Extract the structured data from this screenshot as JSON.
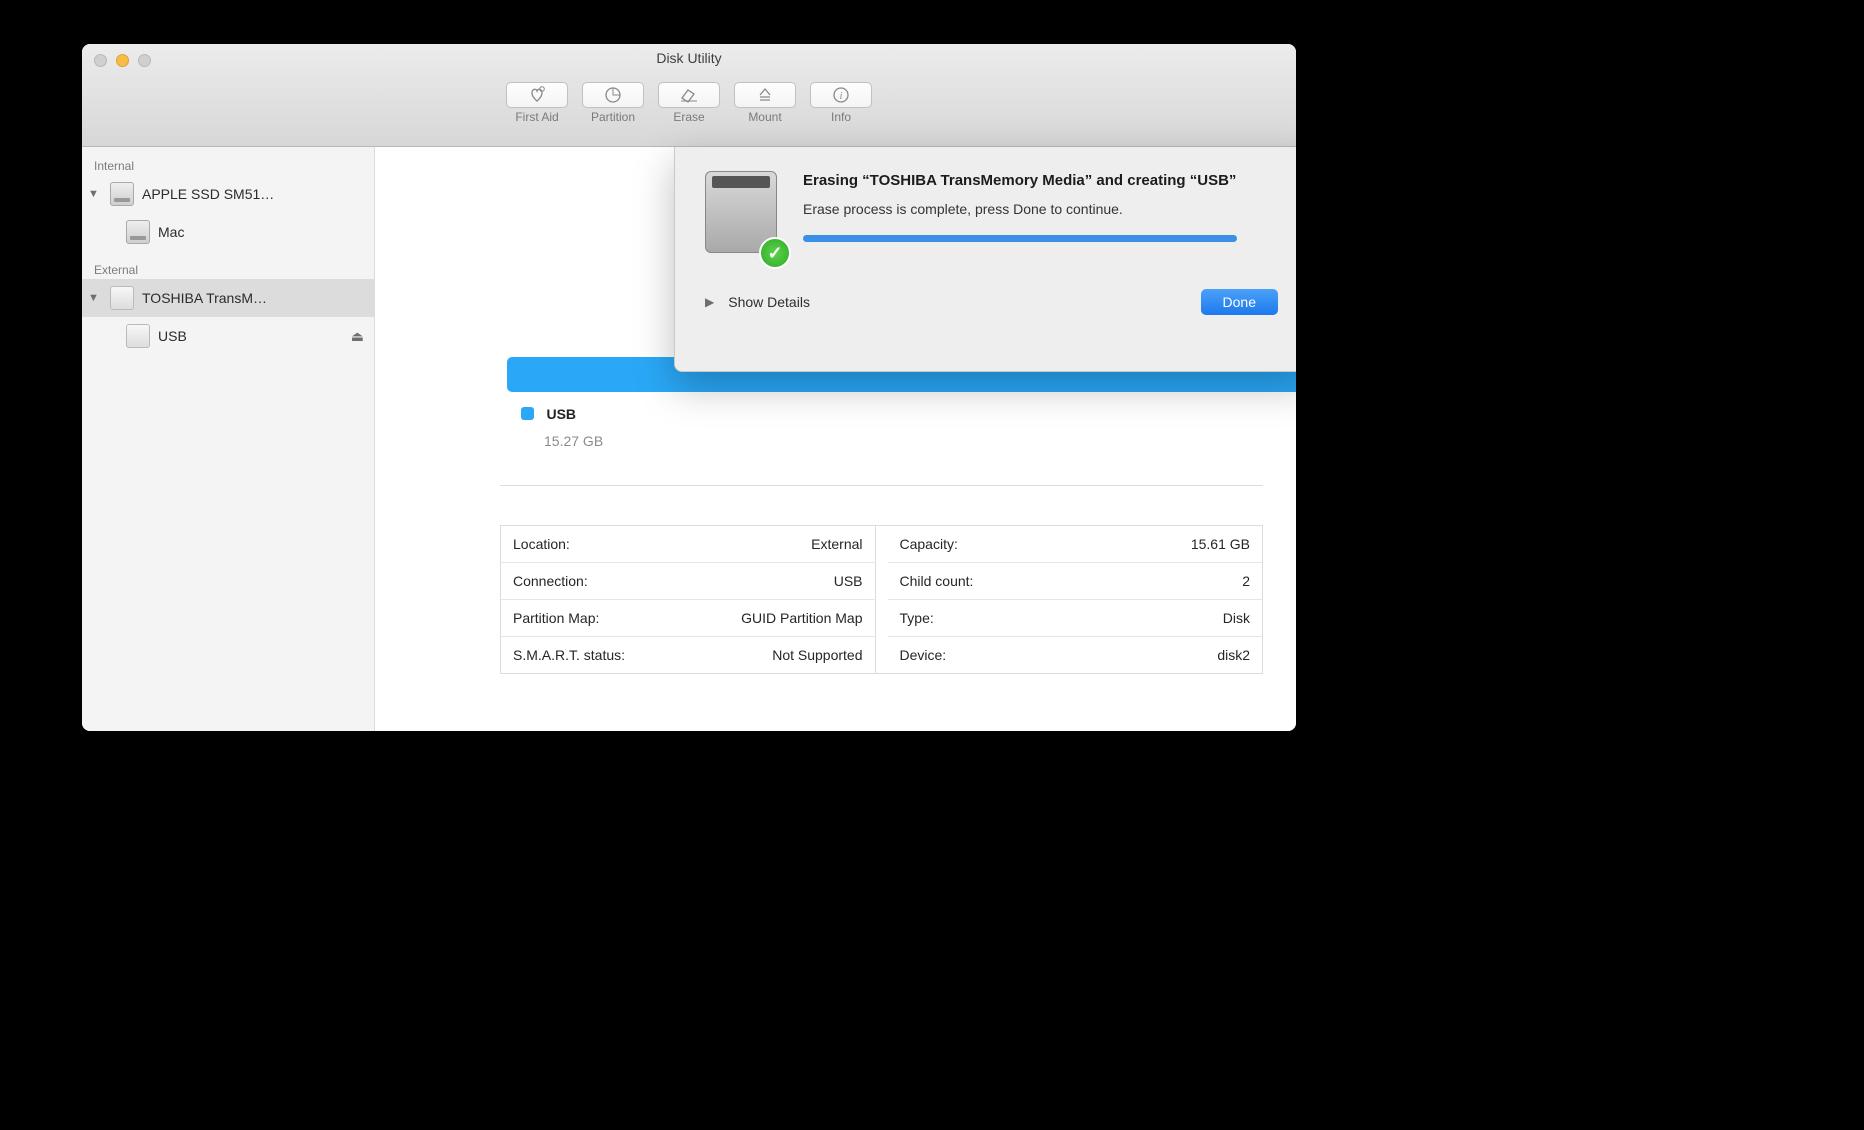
{
  "window": {
    "title": "Disk Utility"
  },
  "toolbar": [
    {
      "id": "first-aid",
      "label": "First Aid"
    },
    {
      "id": "partition",
      "label": "Partition"
    },
    {
      "id": "erase",
      "label": "Erase"
    },
    {
      "id": "mount",
      "label": "Mount"
    },
    {
      "id": "info",
      "label": "Info"
    }
  ],
  "sidebar": {
    "internal_header": "Internal",
    "external_header": "External",
    "internal": {
      "disk": "APPLE SSD SM51…",
      "volume": "Mac"
    },
    "external": {
      "disk": "TOSHIBA TransM…",
      "volume": "USB"
    }
  },
  "main": {
    "volume_name": "USB",
    "volume_size": "15.27 GB",
    "properties_left": [
      {
        "key": "Location:",
        "value": "External"
      },
      {
        "key": "Connection:",
        "value": "USB"
      },
      {
        "key": "Partition Map:",
        "value": "GUID Partition Map"
      },
      {
        "key": "S.M.A.R.T. status:",
        "value": "Not Supported"
      }
    ],
    "properties_right": [
      {
        "key": "Capacity:",
        "value": "15.61 GB"
      },
      {
        "key": "Child count:",
        "value": "2"
      },
      {
        "key": "Type:",
        "value": "Disk"
      },
      {
        "key": "Device:",
        "value": "disk2"
      }
    ]
  },
  "sheet": {
    "title": "Erasing “TOSHIBA TransMemory Media” and creating “USB”",
    "subtitle": "Erase process is complete, press Done to continue.",
    "show_details": "Show Details",
    "done_label": "Done"
  }
}
